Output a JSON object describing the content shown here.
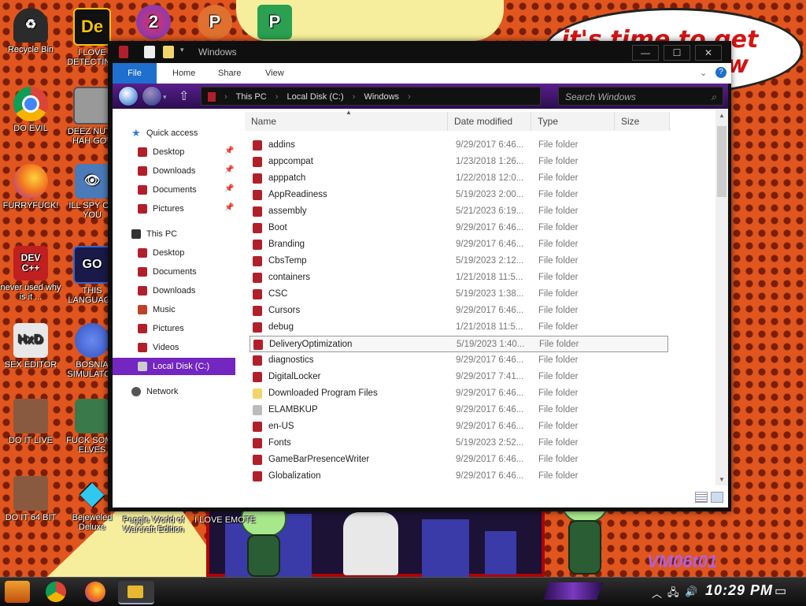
{
  "desktop": {
    "bubble_text": "it's time to get shit done now",
    "watermark": "VM06t01",
    "icons": [
      {
        "id": "recycle-bin",
        "label": "Recycle Bin",
        "color": "#2b2b2b"
      },
      {
        "id": "de",
        "label": "I LOVE DETECTING",
        "color": "#f4c20d"
      },
      {
        "id": "app2",
        "label": "",
        "color": "#6a3fd0"
      },
      {
        "id": "app3",
        "label": "",
        "color": "#e07030"
      },
      {
        "id": "app4",
        "label": "",
        "color": "#2aa050"
      },
      {
        "id": "chrome",
        "label": "DO EVIL",
        "color": "#2f8f3a"
      },
      {
        "id": "deez",
        "label": "DEEZ NUTS HAH GOT",
        "color": "#777777"
      },
      {
        "id": "firefox",
        "label": "FURRYFUCK!",
        "color": "#f07020"
      },
      {
        "id": "spy",
        "label": "ILL SPY ON YOU",
        "color": "#4a7ab8"
      },
      {
        "id": "devcpp",
        "label": "never used why is it ...",
        "color": "#c02020"
      },
      {
        "id": "go",
        "label": "THIS LANGUAGE",
        "color": "#1a1a4a"
      },
      {
        "id": "hxd",
        "label": "SEX EDITOR",
        "color": "#e8e8e8"
      },
      {
        "id": "bosnia",
        "label": "BOSNIA SIMULATOR",
        "color": "#3050c0"
      },
      {
        "id": "doitlive",
        "label": "DO IT LIVE",
        "color": "#8a5a40"
      },
      {
        "id": "elves",
        "label": "FUCK SOME ELVES",
        "color": "#3a7a4a"
      },
      {
        "id": "doit64",
        "label": "DO IT 64 BIT",
        "color": "#8a5a40"
      },
      {
        "id": "bejeweled",
        "label": "Bejeweled Deluxe",
        "color": "#30a8e0"
      },
      {
        "id": "peggle",
        "label": "Peggle World of Warcraft Edition",
        "color": "#ffffff"
      },
      {
        "id": "emote",
        "label": "I LOVE EMOTE",
        "color": "#ffffff"
      }
    ]
  },
  "window": {
    "title": "Windows",
    "controls": {
      "minimize": "—",
      "maximize": "☐",
      "close": "✕"
    },
    "ribbon_tabs": [
      "File",
      "Home",
      "Share",
      "View"
    ],
    "address": {
      "segments": [
        "This PC",
        "Local Disk (C:)",
        "Windows"
      ]
    },
    "search_placeholder": "Search Windows",
    "nav": {
      "quick_access": "Quick access",
      "quick_items": [
        "Desktop",
        "Downloads",
        "Documents",
        "Pictures"
      ],
      "this_pc": "This PC",
      "pc_items": [
        "Desktop",
        "Documents",
        "Downloads",
        "Music",
        "Pictures",
        "Videos"
      ],
      "local_disk": "Local Disk (C:)",
      "network": "Network"
    },
    "columns": [
      "Name",
      "Date modified",
      "Type",
      "Size"
    ],
    "files": [
      {
        "name": "addins",
        "date": "9/29/2017 6:46...",
        "type": "File folder"
      },
      {
        "name": "appcompat",
        "date": "1/23/2018 1:26...",
        "type": "File folder"
      },
      {
        "name": "apppatch",
        "date": "1/22/2018 12:0...",
        "type": "File folder"
      },
      {
        "name": "AppReadiness",
        "date": "5/19/2023 2:00...",
        "type": "File folder"
      },
      {
        "name": "assembly",
        "date": "5/21/2023 6:19...",
        "type": "File folder"
      },
      {
        "name": "Boot",
        "date": "9/29/2017 6:46...",
        "type": "File folder"
      },
      {
        "name": "Branding",
        "date": "9/29/2017 6:46...",
        "type": "File folder"
      },
      {
        "name": "CbsTemp",
        "date": "5/19/2023 2:12...",
        "type": "File folder"
      },
      {
        "name": "containers",
        "date": "1/21/2018 11:5...",
        "type": "File folder"
      },
      {
        "name": "CSC",
        "date": "5/19/2023 1:38...",
        "type": "File folder"
      },
      {
        "name": "Cursors",
        "date": "9/29/2017 6:46...",
        "type": "File folder"
      },
      {
        "name": "debug",
        "date": "1/21/2018 11:5...",
        "type": "File folder"
      },
      {
        "name": "DeliveryOptimization",
        "date": "5/19/2023 1:40...",
        "type": "File folder"
      },
      {
        "name": "diagnostics",
        "date": "9/29/2017 6:46...",
        "type": "File folder"
      },
      {
        "name": "DigitalLocker",
        "date": "9/29/2017 7:41...",
        "type": "File folder"
      },
      {
        "name": "Downloaded Program Files",
        "date": "9/29/2017 6:46...",
        "type": "File folder"
      },
      {
        "name": "ELAMBKUP",
        "date": "9/29/2017 6:46...",
        "type": "File folder"
      },
      {
        "name": "en-US",
        "date": "9/29/2017 6:46...",
        "type": "File folder"
      },
      {
        "name": "Fonts",
        "date": "5/19/2023 2:52...",
        "type": "File folder"
      },
      {
        "name": "GameBarPresenceWriter",
        "date": "9/29/2017 6:46...",
        "type": "File folder"
      },
      {
        "name": "Globalization",
        "date": "9/29/2017 6:46...",
        "type": "File folder"
      }
    ],
    "hovered_index": 12
  },
  "taskbar": {
    "clock": "10:29 PM",
    "pinned": [
      {
        "id": "start",
        "color": "#e08020"
      },
      {
        "id": "chrome",
        "color": "#2f8f3a"
      },
      {
        "id": "firefox",
        "color": "#f07020"
      },
      {
        "id": "explorer",
        "color": "#e8b830"
      }
    ]
  },
  "colors": {
    "accent": "#1e6fce",
    "nav_selected": "#7326c0",
    "folder_icon": "#b0202a",
    "address_bar": "#5a1f8c"
  }
}
